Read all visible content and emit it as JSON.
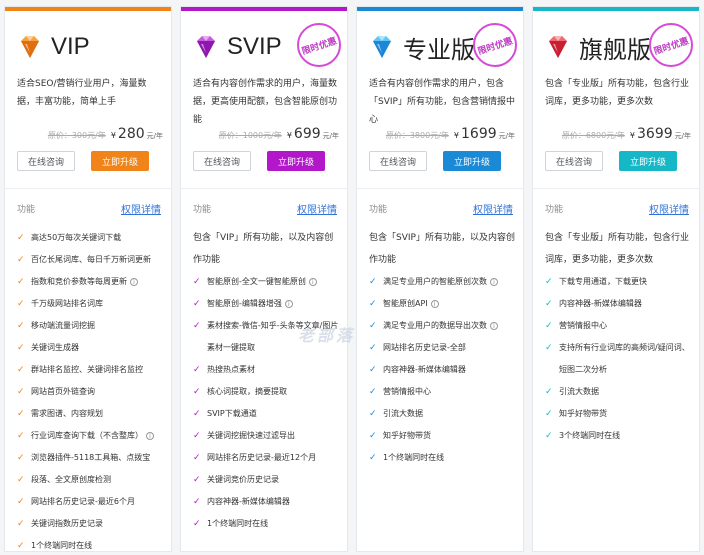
{
  "plans": [
    {
      "name": "VIP",
      "icon": "orange-diamond-icon",
      "color": "#f08418",
      "stamp": "",
      "description": "适合SEO/营销行业用户，海量数据，丰富功能，简单上手",
      "original_price": "原价：300元/年",
      "currency": "¥",
      "price": "280",
      "unit": "元/年",
      "consult_label": "在线咨询",
      "upgrade_label": "立即升级",
      "features_label": "功能",
      "details_label": "权限详情",
      "intro": "",
      "features": [
        {
          "text": "高达50万每次关键词下载",
          "info": false
        },
        {
          "text": "百亿长尾词库、每日千万新词更新",
          "info": false
        },
        {
          "text": "指数和竞价参数等每周更新",
          "info": true
        },
        {
          "text": "千万级网站排名词库",
          "info": false
        },
        {
          "text": "移动端流量词挖掘",
          "info": false
        },
        {
          "text": "关键词生成器",
          "info": false
        },
        {
          "text": "群站排名监控、关键词排名监控",
          "info": false
        },
        {
          "text": "网站首页外链查询",
          "info": false
        },
        {
          "text": "需求图谱、内容规划",
          "info": false
        },
        {
          "text": "行业词库查询下载（不含整库）",
          "info": true
        },
        {
          "text": "浏览器插件-5118工具箱、点拨宝",
          "info": false
        },
        {
          "text": "段落、全文原创度检测",
          "info": false
        },
        {
          "text": "网站排名历史记录-最近6个月",
          "info": false
        },
        {
          "text": "关键词指数历史记录",
          "info": false
        },
        {
          "text": "1个终端同时在线",
          "info": false
        }
      ]
    },
    {
      "name": "SVIP",
      "icon": "purple-diamond-icon",
      "color": "#b217c9",
      "stamp": "限时优惠",
      "description": "适合有内容创作需求的用户，海量数据，更高使用配额，包含智能原创功能",
      "original_price": "原价：1000元/年",
      "currency": "¥",
      "price": "699",
      "unit": "元/年",
      "consult_label": "在线咨询",
      "upgrade_label": "立即升级",
      "features_label": "功能",
      "details_label": "权限详情",
      "intro": "包含「VIP」所有功能，以及内容创作功能",
      "features": [
        {
          "text": "智能原创-全文一键智能原创",
          "info": true
        },
        {
          "text": "智能原创-编辑器增强",
          "info": true
        },
        {
          "text": "素材搜索-微信-知乎-头条等文章/图片素材一键提取",
          "info": false
        },
        {
          "text": "热搜热点素材",
          "info": false
        },
        {
          "text": "核心词提取，摘要提取",
          "info": false
        },
        {
          "text": "SVIP下载通道",
          "info": false
        },
        {
          "text": "关键词挖掘快速过滤导出",
          "info": false
        },
        {
          "text": "网站排名历史记录-最近12个月",
          "info": false
        },
        {
          "text": "关键词竞价历史记录",
          "info": false
        },
        {
          "text": "内容神器-新媒体编辑器",
          "info": false
        },
        {
          "text": "1个终端同时在线",
          "info": false
        }
      ]
    },
    {
      "name": "专业版",
      "icon": "blue-diamond-icon",
      "color": "#1a8ad6",
      "stamp": "限时优惠",
      "description": "适合有内容创作需求的用户，包含「SVIP」所有功能，包含营销情报中心",
      "original_price": "原价：3800元/年",
      "currency": "¥",
      "price": "1699",
      "unit": "元/年",
      "consult_label": "在线咨询",
      "upgrade_label": "立即升级",
      "features_label": "功能",
      "details_label": "权限详情",
      "intro": "包含「SVIP」所有功能，以及内容创作功能",
      "features": [
        {
          "text": "满足专业用户的智能原创次数",
          "info": true
        },
        {
          "text": "智能原创API",
          "info": true
        },
        {
          "text": "满足专业用户的数据导出次数",
          "info": true
        },
        {
          "text": "网站排名历史记录-全部",
          "info": false
        },
        {
          "text": "内容神器-新媒体编辑器",
          "info": false
        },
        {
          "text": "营销情报中心",
          "info": false
        },
        {
          "text": "引流大数据",
          "info": false
        },
        {
          "text": "知乎好物带货",
          "info": false
        },
        {
          "text": "1个终端同时在线",
          "info": false
        }
      ]
    },
    {
      "name": "旗舰版",
      "icon": "red-diamond-icon",
      "color": "#16b8c8",
      "stamp": "限时优惠",
      "description": "包含「专业版」所有功能，包含行业词库，更多功能，更多次数",
      "original_price": "原价：6800元/年",
      "currency": "¥",
      "price": "3699",
      "unit": "元/年",
      "consult_label": "在线咨询",
      "upgrade_label": "立即升级",
      "features_label": "功能",
      "details_label": "权限详情",
      "intro": "包含「专业版」所有功能，包含行业词库，更多功能，更多次数",
      "features": [
        {
          "text": "下载专用通道，下载更快",
          "info": false
        },
        {
          "text": "内容神器-新媒体编辑器",
          "info": false
        },
        {
          "text": "营销情报中心",
          "info": false
        },
        {
          "text": "支持所有行业词库的高频词/疑问词、短图二次分析",
          "info": false
        },
        {
          "text": "引流大数据",
          "info": false
        },
        {
          "text": "知乎好物带货",
          "info": false
        },
        {
          "text": "3个终端同时在线",
          "info": false
        }
      ]
    }
  ],
  "watermark": "老部落"
}
